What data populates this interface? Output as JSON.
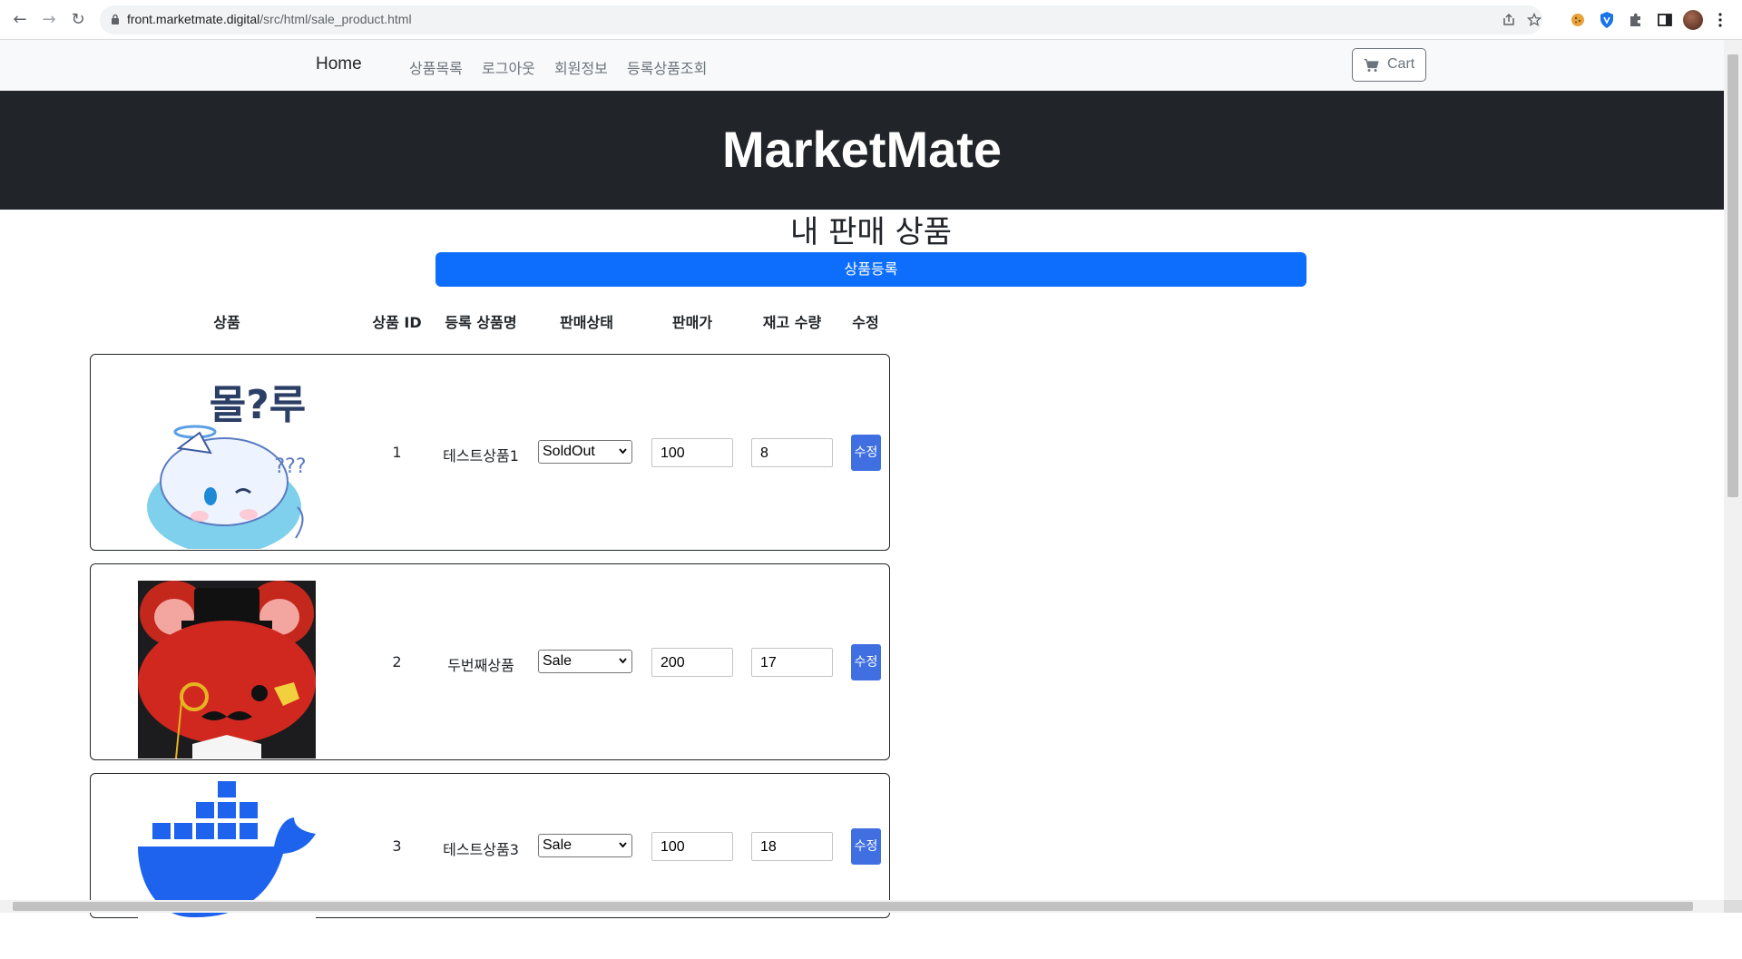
{
  "browser": {
    "url_host": "front.marketmate.digital",
    "url_path": "/src/html/sale_product.html",
    "back_icon": "←",
    "forward_icon": "→",
    "reload_icon": "↻"
  },
  "nav": {
    "home": "Home",
    "links": [
      "상품목록",
      "로그아웃",
      "회원정보",
      "등록상품조회"
    ],
    "cart_label": "Cart"
  },
  "hero": {
    "title": "MarketMate"
  },
  "page": {
    "title": "내 판매 상품",
    "register_button": "상품등록"
  },
  "table": {
    "headers": {
      "product": "상품",
      "product_id": "상품 ID",
      "name": "등록 상품명",
      "status": "판매상태",
      "price": "판매가",
      "stock": "재고 수량",
      "edit": "수정"
    },
    "rows": [
      {
        "id": "1",
        "name": "테스트상품1",
        "status": "SoldOut",
        "price": "100",
        "stock": "8",
        "edit": "수정"
      },
      {
        "id": "2",
        "name": "두번째상품",
        "status": "Sale",
        "price": "200",
        "stock": "17",
        "edit": "수정"
      },
      {
        "id": "3",
        "name": "테스트상품3",
        "status": "Sale",
        "price": "100",
        "stock": "18",
        "edit": "수정"
      }
    ]
  },
  "images": {
    "row1_caption": "몰?루",
    "row1_marks": "???"
  },
  "colors": {
    "primary": "#0d6efd",
    "edit_button": "#3f6fe0",
    "hero_bg": "#212529"
  }
}
